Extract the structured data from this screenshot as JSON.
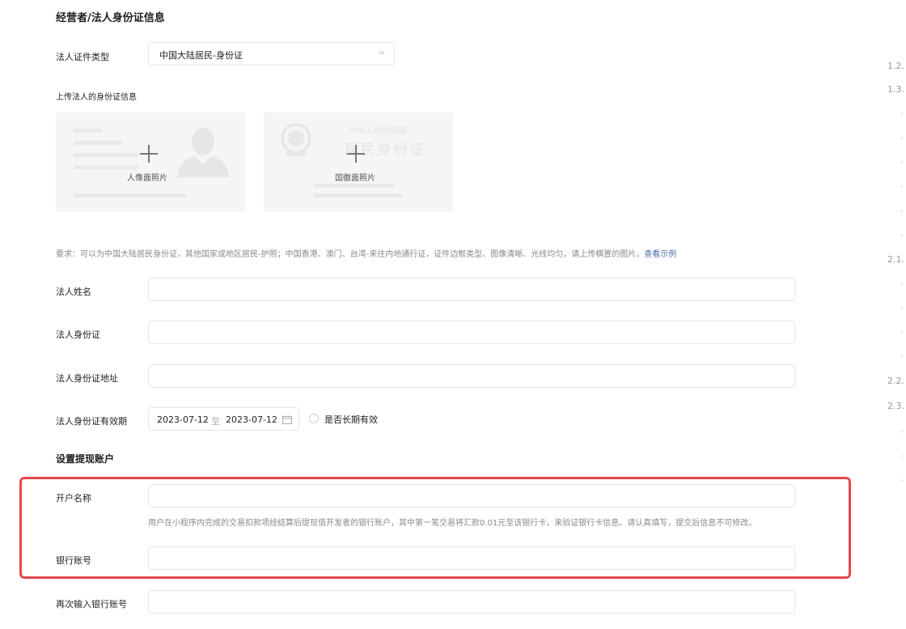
{
  "section1": {
    "title": "经营者/法人身份证信息"
  },
  "id_type": {
    "label": "法人证件类型",
    "value": "中国大陆居民-身份证"
  },
  "upload": {
    "label": "上传法人的身份证信息",
    "front_caption": "人像面照片",
    "back_caption": "国徽面照片",
    "back_card_title": "中华人民共和国",
    "back_card_subtitle": "居民身份证",
    "requirement": "要求：可以为中国大陆居民身份证，其他国家或地区居民-护照；中国香港、澳门、台湾-来往内地通行证，证件边框类型、图像清晰、光线均匀，请上传横置的图片。",
    "example_link": "查看示例"
  },
  "legal_name": {
    "label": "法人姓名",
    "value": ""
  },
  "legal_id": {
    "label": "法人身份证",
    "value": ""
  },
  "legal_address": {
    "label": "法人身份证地址",
    "value": ""
  },
  "validity": {
    "label": "法人身份证有效期",
    "start": "2023-07-12",
    "sep": "至",
    "end": "2023-07-12",
    "long_term_label": "是否长期有效"
  },
  "section2": {
    "title": "设置提现账户"
  },
  "account_name": {
    "label": "开户名称",
    "value": "",
    "hint": "用户在小程序内完成的交易扣款项经结算后提现值开发者的银行账户，其中第一笔交易将汇款0.01元至该银行卡，来验证银行卡信息。请认真填写，提交后信息不可修改。"
  },
  "bank_account": {
    "label": "银行账号",
    "value": ""
  },
  "bank_account_confirm": {
    "label": "再次输入银行账号",
    "value": ""
  },
  "toc": [
    "1.2.",
    "1.3.",
    "2.1.",
    "2.2.",
    "2.3."
  ],
  "colors": {
    "highlight": "#e5484d",
    "link": "#4b6ea8",
    "border": "#e5e6eb"
  },
  "icons": [
    "chevron-down-icon",
    "plus-icon",
    "calendar-icon",
    "radio-icon"
  ]
}
